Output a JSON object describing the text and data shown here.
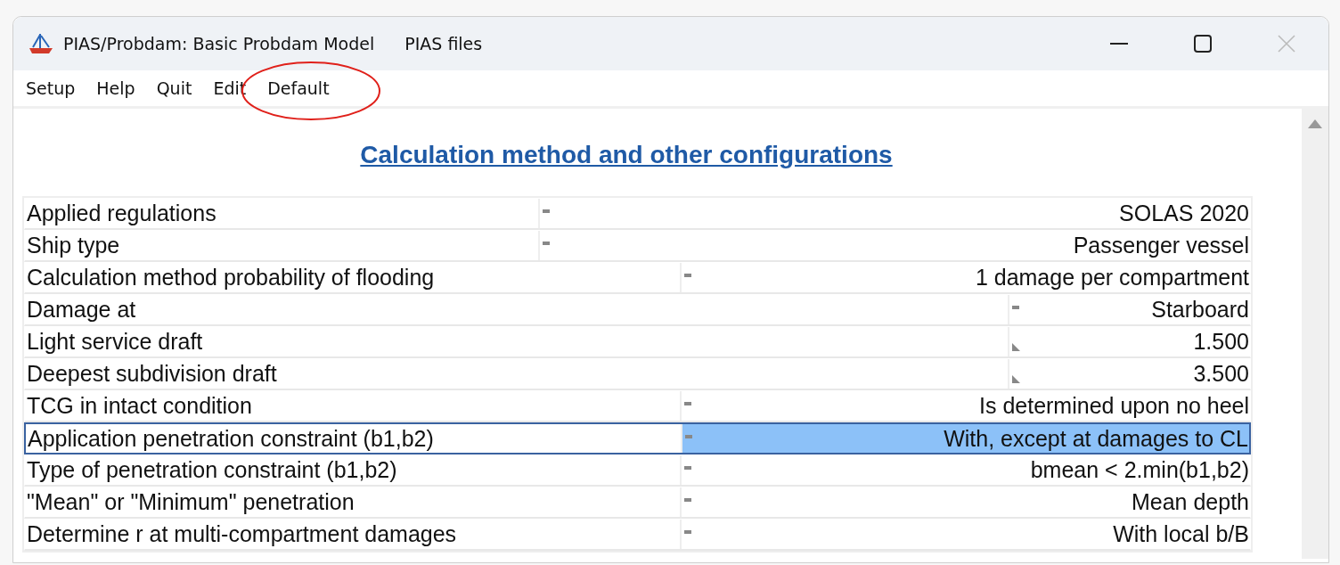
{
  "window": {
    "title": "PIAS/Probdam: Basic Probdam Model",
    "subtitle": "PIAS files"
  },
  "menu": [
    {
      "label": "Setup",
      "circled": false
    },
    {
      "label": "Help",
      "circled": false
    },
    {
      "label": "Quit",
      "circled": false
    },
    {
      "label": "Edit",
      "circled": false
    },
    {
      "label": "Default",
      "circled": true
    }
  ],
  "heading": "Calculation method and other configurations",
  "rows": [
    {
      "label": "Applied regulations",
      "value": "SOLAS 2020",
      "kind": "setting",
      "selected": false
    },
    {
      "label": "Ship type",
      "value": "Passenger vessel",
      "kind": "setting",
      "selected": false
    },
    {
      "label": "Calculation method probability of flooding",
      "value": "1 damage per compartment",
      "kind": "option",
      "selected": false
    },
    {
      "label": "Damage at",
      "value": "Starboard",
      "kind": "side",
      "selected": false
    },
    {
      "label": "Light service draft",
      "value": "1.500",
      "kind": "number",
      "selected": false
    },
    {
      "label": "Deepest subdivision draft",
      "value": "3.500",
      "kind": "number",
      "selected": false
    },
    {
      "label": "TCG in intact condition",
      "value": "Is determined upon no heel",
      "kind": "option",
      "selected": false
    },
    {
      "label": "Application penetration constraint (b1,b2)",
      "value": "With, except at damages to CL",
      "kind": "option",
      "selected": true
    },
    {
      "label": "Type of penetration constraint (b1,b2)",
      "value": "bmean < 2.min(b1,b2)",
      "kind": "option",
      "selected": false
    },
    {
      "label": "\"Mean\" or \"Minimum\" penetration",
      "value": "Mean depth",
      "kind": "option",
      "selected": false
    },
    {
      "label": "Determine r at multi-compartment damages",
      "value": "With local b/B",
      "kind": "option",
      "selected": false
    }
  ]
}
